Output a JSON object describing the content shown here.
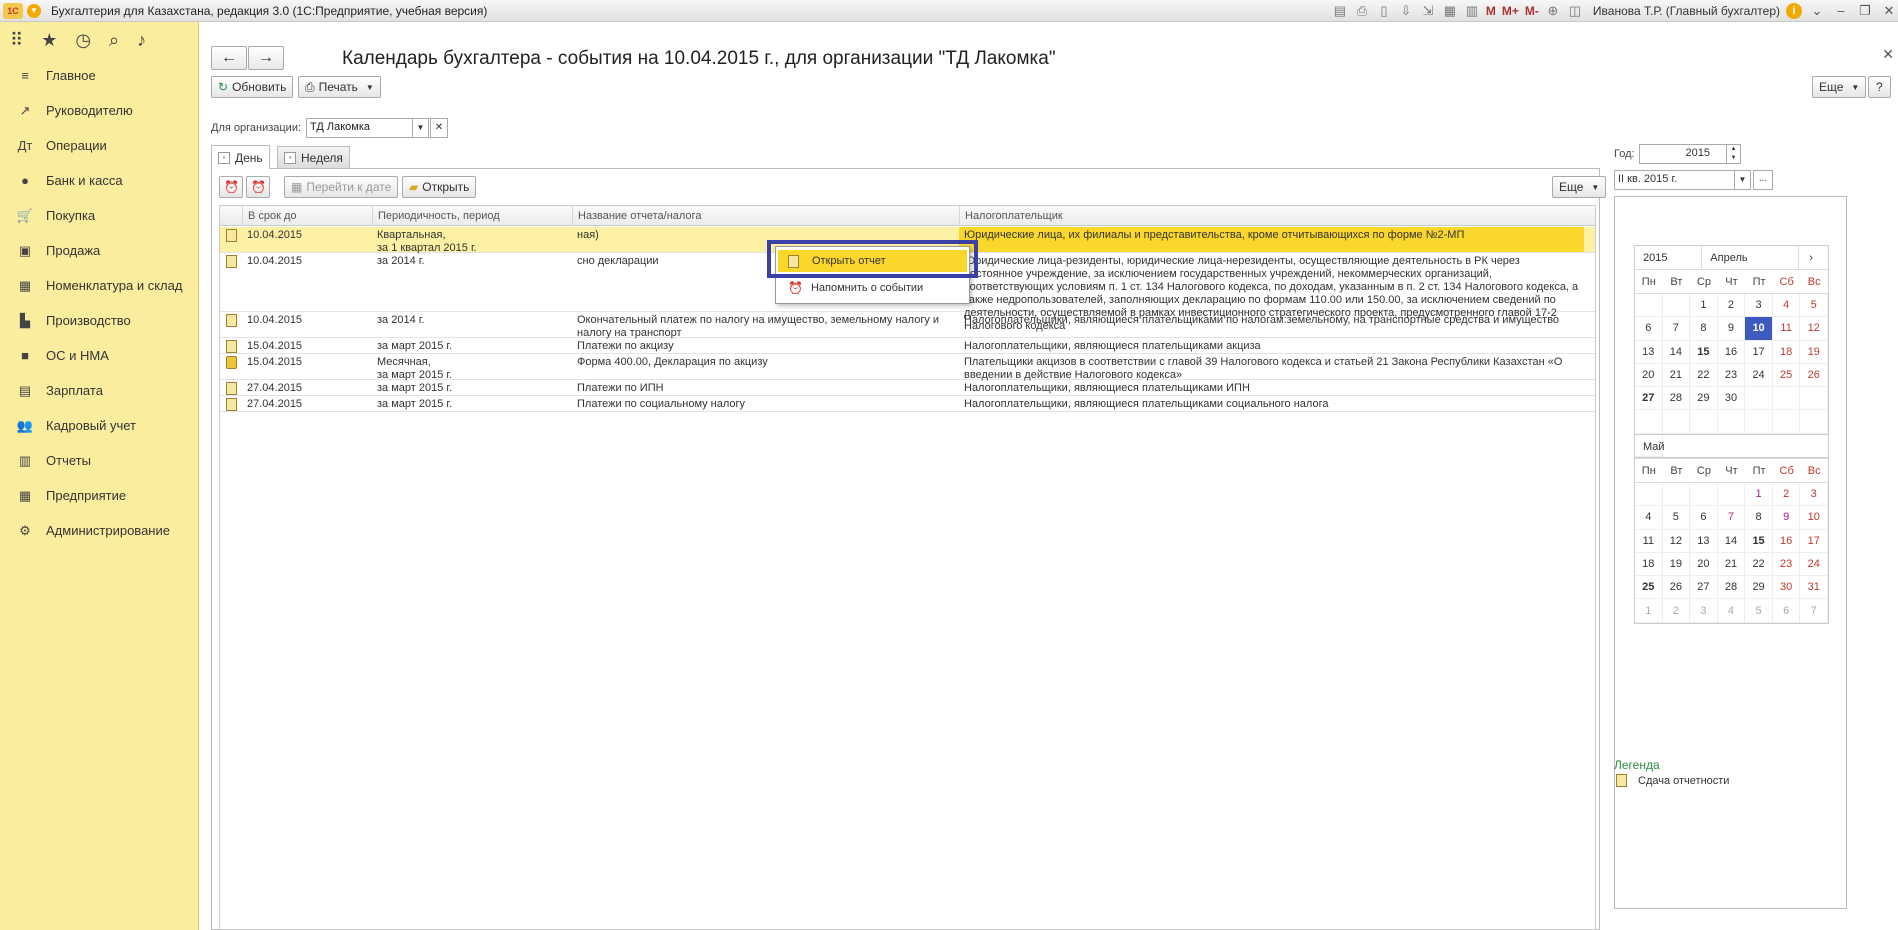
{
  "app": {
    "title": "Бухгалтерия для Казахстана, редакция 3.0  (1С:Предприятие, учебная версия)",
    "logo": "1С",
    "user": "Иванова Т.Р. (Главный бухгалтер)",
    "mm": [
      "M",
      "M+",
      "M-"
    ]
  },
  "sidebar": {
    "items": [
      {
        "label": "Главное",
        "icon": "≡"
      },
      {
        "label": "Руководителю",
        "icon": "↗"
      },
      {
        "label": "Операции",
        "icon": "Дт"
      },
      {
        "label": "Банк и касса",
        "icon": "●"
      },
      {
        "label": "Покупка",
        "icon": "🛒"
      },
      {
        "label": "Продажа",
        "icon": "▣"
      },
      {
        "label": "Номенклатура и склад",
        "icon": "▦"
      },
      {
        "label": "Производство",
        "icon": "▙"
      },
      {
        "label": "ОС и НМА",
        "icon": "■"
      },
      {
        "label": "Зарплата",
        "icon": "▤"
      },
      {
        "label": "Кадровый учет",
        "icon": "👥"
      },
      {
        "label": "Отчеты",
        "icon": "▥"
      },
      {
        "label": "Предприятие",
        "icon": "▦"
      },
      {
        "label": "Администрирование",
        "icon": "⚙"
      }
    ]
  },
  "page": {
    "title": "Календарь бухгалтера - события на 10.04.2015 г., для организации \"ТД Лакомка\"",
    "refresh_label": "Обновить",
    "print_label": "Печать",
    "more_label": "Еще",
    "help_label": "?",
    "org_label": "Для организации:",
    "org_value": "ТД Лакомка",
    "tabs": [
      {
        "label": "День"
      },
      {
        "label": "Неделя"
      }
    ],
    "goto_date_label": "Перейти к дате",
    "open_label": "Открыть",
    "grid_more_label": "Еще"
  },
  "grid": {
    "columns": [
      "В срок до",
      "Периодичность, период",
      "Название отчета/налога",
      "Налогоплательщик"
    ],
    "rows": [
      {
        "date": "10.04.2015",
        "period": "Квартальная,\nза 1 квартал 2015 г.",
        "name": "ная)",
        "payer": "Юридические лица, их филиалы и представительства, кроме отчитывающихся по форме №2-МП"
      },
      {
        "date": "10.04.2015",
        "period": "за 2014 г.",
        "name": "сно декларации",
        "payer": "Юридические лица-резиденты, юридические лица-нерезиденты, осуществляющие деятельность в РК через постоянное учреждение, за исключением государственных учреждений, некоммерческих организаций, соответствующих условиям п. 1 ст. 134 Налогового кодекса, по доходам, указанным в п. 2 ст. 134 Налогового кодекса, а также недропользователей, заполняющих декларацию по формам 110.00 или 150.00, за исключением сведений по деятельности, осуществляемой в рамках инвестиционного стратегического проекта, предусмотренного главой 17-2 Налогового кодекса"
      },
      {
        "date": "10.04.2015",
        "period": "за 2014 г.",
        "name": "Окончательный платеж по налогу на имущество, земельному налогу и налогу на транспорт",
        "payer": "Налогоплательщики, являющиеся плательщиками по налогам:земельному, на транспортные средства и имущество"
      },
      {
        "date": "15.04.2015",
        "period": "за март 2015 г.",
        "name": "Платежи по акцизу",
        "payer": "Налогоплательщики, являющиеся плательщиками акциза"
      },
      {
        "date": "15.04.2015",
        "period": "Месячная,\nза март 2015 г.",
        "name": "Форма 400.00, Декларация по акцизу",
        "payer": "Плательщики акцизов в соответствии с главой 39 Налогового кодекса и статьей 21 Закона Республики Казахстан «О введении в действие Налогового кодекса»"
      },
      {
        "date": "27.04.2015",
        "period": "за март 2015 г.",
        "name": "Платежи по ИПН",
        "payer": "Налогоплательщики, являющиеся плательщиками ИПН"
      },
      {
        "date": "27.04.2015",
        "period": "за март 2015 г.",
        "name": "Платежи по социальному налогу",
        "payer": "Налогоплательщики, являющиеся плательщиками социального налога"
      }
    ]
  },
  "context_menu": {
    "open_report": "Открыть отчет",
    "remind": "Напомнить о событии"
  },
  "right": {
    "year_label": "Год:",
    "year_value": "2015",
    "quarter_value": "II кв. 2015 г.",
    "quarter_more": "...",
    "dow": [
      "Пн",
      "Вт",
      "Ср",
      "Чт",
      "Пт",
      "Сб",
      "Вс"
    ],
    "april": {
      "year": "2015",
      "month": "Апрель",
      "next": "›",
      "days": [
        "",
        "",
        "1",
        "2",
        "3",
        "4",
        "5",
        "6",
        "7",
        "8",
        "9",
        "10",
        "11",
        "12",
        "13",
        "14",
        "15",
        "16",
        "17",
        "18",
        "19",
        "20",
        "21",
        "22",
        "23",
        "24",
        "25",
        "26",
        "27",
        "28",
        "29",
        "30",
        "",
        "",
        "",
        "",
        "",
        "",
        "",
        "",
        "",
        "",
        ""
      ]
    },
    "may": {
      "month": "Май",
      "days": [
        "",
        "",
        "",
        "",
        "1",
        "2",
        "3",
        "4",
        "5",
        "6",
        "7",
        "8",
        "9",
        "10",
        "11",
        "12",
        "13",
        "14",
        "15",
        "16",
        "17",
        "18",
        "19",
        "20",
        "21",
        "22",
        "23",
        "24",
        "25",
        "26",
        "27",
        "28",
        "29",
        "30",
        "31",
        "1",
        "2",
        "3",
        "4",
        "5",
        "6",
        "7"
      ]
    },
    "legend_title": "Легенда",
    "legend_item": "Сдача отчетности"
  }
}
